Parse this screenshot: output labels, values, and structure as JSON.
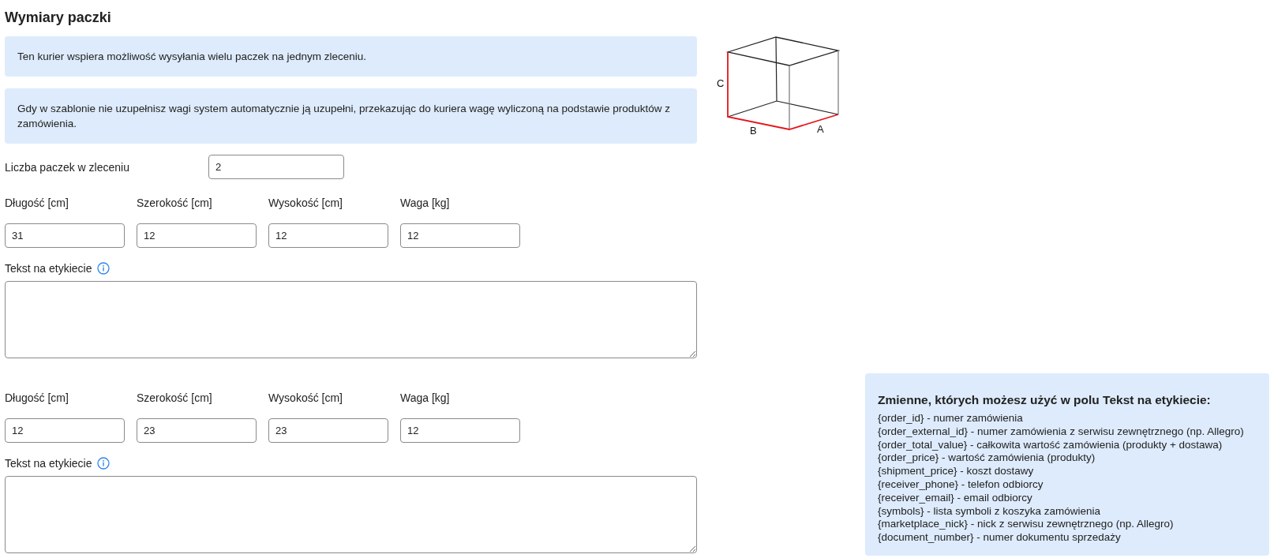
{
  "title": "Wymiary paczki",
  "info_boxes": [
    "Ten kurier wspiera możliwość wysyłania wielu paczek na jednym zleceniu.",
    "Gdy w szablonie nie uzupełnisz wagi system automatycznie ją uzupełni, przekazując do kuriera wagę wyliczoną na podstawie produktów z zamówienia."
  ],
  "package_count": {
    "label": "Liczba paczek w zleceniu",
    "value": "2"
  },
  "packages": [
    {
      "fields": [
        {
          "label": "Długość [cm]",
          "value": "31"
        },
        {
          "label": "Szerokość [cm]",
          "value": "12"
        },
        {
          "label": "Wysokość [cm]",
          "value": "12"
        },
        {
          "label": "Waga [kg]",
          "value": "12"
        }
      ],
      "label_text": {
        "label": "Tekst na etykiecie"
      }
    },
    {
      "fields": [
        {
          "label": "Długość [cm]",
          "value": "12"
        },
        {
          "label": "Szerokość [cm]",
          "value": "23"
        },
        {
          "label": "Wysokość [cm]",
          "value": "23"
        },
        {
          "label": "Waga [kg]",
          "value": "12"
        }
      ],
      "label_text": {
        "label": "Tekst na etykiecie"
      }
    }
  ],
  "diagram": {
    "labels": [
      "C",
      "B",
      "A"
    ]
  },
  "variables": {
    "title": "Zmienne, których możesz użyć w polu Tekst na etykiecie:",
    "items": [
      "{order_id} - numer zamówienia",
      "{order_external_id} - numer zamówienia z serwisu zewnętrznego (np. Allegro)",
      "{order_total_value} - całkowita wartość zamówienia (produkty + dostawa)",
      "{order_price} - wartość zamówienia (produkty)",
      "{shipment_price} - koszt dostawy",
      "{receiver_phone} - telefon odbiorcy",
      "{receiver_email} - email odbiorcy",
      "{symbols} - lista symboli z koszyka zamówienia",
      "{marketplace_nick} - nick z serwisu zewnętrznego (np. Allegro)",
      "{document_number} - numer dokumentu sprzedaży"
    ]
  }
}
